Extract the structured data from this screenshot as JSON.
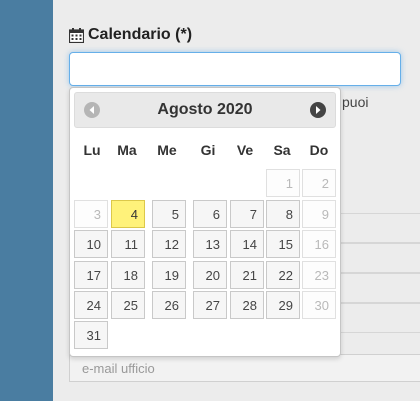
{
  "form": {
    "calendar_label": "Calendario (*)",
    "date_value": "",
    "help_text_partial": "puoi",
    "email_placeholder": "e-mail ufficio"
  },
  "datepicker": {
    "month_year": "Agosto 2020",
    "prev_icon": "chevron-left-icon",
    "next_icon": "chevron-right-icon",
    "weekdays": [
      "Lu",
      "Ma",
      "Me",
      "Gi",
      "Ve",
      "Sa",
      "Do"
    ],
    "today": "4",
    "weeks": [
      [
        "",
        "",
        "",
        "",
        "",
        "1",
        "2"
      ],
      [
        "3",
        "4",
        "5",
        "6",
        "7",
        "8",
        "9"
      ],
      [
        "10",
        "11",
        "12",
        "13",
        "14",
        "15",
        "16"
      ],
      [
        "17",
        "18",
        "19",
        "20",
        "21",
        "22",
        "23"
      ],
      [
        "24",
        "25",
        "26",
        "27",
        "28",
        "29",
        "30"
      ],
      [
        "31"
      ]
    ]
  },
  "colors": {
    "sidebar": "#4a7da1",
    "today_highlight": "#fff27a",
    "input_focus": "#66afe9"
  }
}
